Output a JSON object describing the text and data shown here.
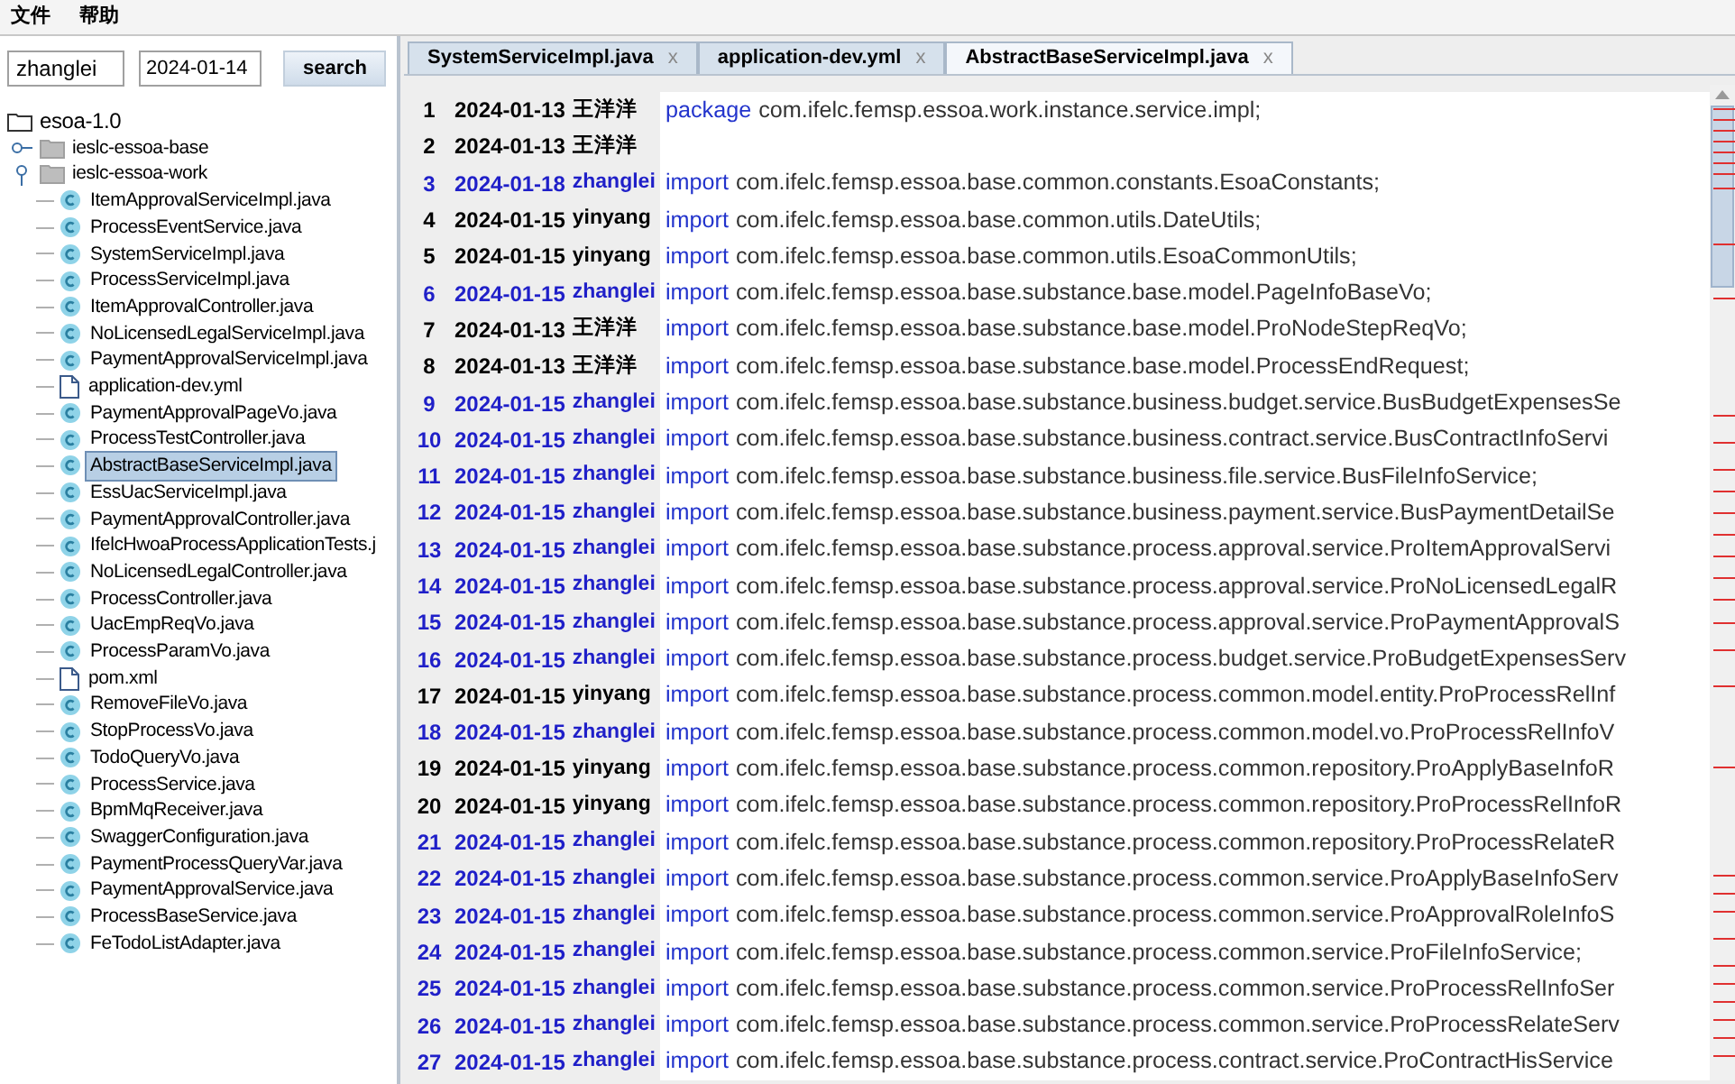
{
  "menu": [
    "文件",
    "帮助"
  ],
  "search": {
    "author": "zhanglei",
    "date": "2024-01-14",
    "button": "search"
  },
  "tree": {
    "label": "esoa-1.0",
    "expanded": true,
    "children": [
      {
        "label": "ieslc-essoa-base",
        "expanded": false
      },
      {
        "label": "ieslc-essoa-work",
        "expanded": true,
        "children": [
          {
            "label": "ItemApprovalServiceImpl.java",
            "kind": "java",
            "selected": false
          },
          {
            "label": "ProcessEventService.java",
            "kind": "java",
            "selected": false
          },
          {
            "label": "SystemServiceImpl.java",
            "kind": "java",
            "selected": false
          },
          {
            "label": "ProcessServiceImpl.java",
            "kind": "java",
            "selected": false
          },
          {
            "label": "ItemApprovalController.java",
            "kind": "java",
            "selected": false
          },
          {
            "label": "NoLicensedLegalServiceImpl.java",
            "kind": "java",
            "selected": false
          },
          {
            "label": "PaymentApprovalServiceImpl.java",
            "kind": "java",
            "selected": false
          },
          {
            "label": "application-dev.yml",
            "kind": "file",
            "selected": false
          },
          {
            "label": "PaymentApprovalPageVo.java",
            "kind": "java",
            "selected": false
          },
          {
            "label": "ProcessTestController.java",
            "kind": "java",
            "selected": false
          },
          {
            "label": "AbstractBaseServiceImpl.java",
            "kind": "java",
            "selected": true
          },
          {
            "label": "EssUacServiceImpl.java",
            "kind": "java",
            "selected": false
          },
          {
            "label": "PaymentApprovalController.java",
            "kind": "java",
            "selected": false
          },
          {
            "label": "IfelcHwoaProcessApplicationTests.j",
            "kind": "java",
            "selected": false
          },
          {
            "label": "NoLicensedLegalController.java",
            "kind": "java",
            "selected": false
          },
          {
            "label": "ProcessController.java",
            "kind": "java",
            "selected": false
          },
          {
            "label": "UacEmpReqVo.java",
            "kind": "java",
            "selected": false
          },
          {
            "label": "ProcessParamVo.java",
            "kind": "java",
            "selected": false
          },
          {
            "label": "pom.xml",
            "kind": "file",
            "selected": false
          },
          {
            "label": "RemoveFileVo.java",
            "kind": "java",
            "selected": false
          },
          {
            "label": "StopProcessVo.java",
            "kind": "java",
            "selected": false
          },
          {
            "label": "TodoQueryVo.java",
            "kind": "java",
            "selected": false
          },
          {
            "label": "ProcessService.java",
            "kind": "java",
            "selected": false
          },
          {
            "label": "BpmMqReceiver.java",
            "kind": "java",
            "selected": false
          },
          {
            "label": "SwaggerConfiguration.java",
            "kind": "java",
            "selected": false
          },
          {
            "label": "PaymentProcessQueryVar.java",
            "kind": "java",
            "selected": false
          },
          {
            "label": "PaymentApprovalService.java",
            "kind": "java",
            "selected": false
          },
          {
            "label": "ProcessBaseService.java",
            "kind": "java",
            "selected": false
          },
          {
            "label": "FeTodoListAdapter.java",
            "kind": "java",
            "selected": false
          }
        ]
      }
    ]
  },
  "tabs": [
    {
      "label": "SystemServiceImpl.java",
      "close": "x",
      "selected": false
    },
    {
      "label": "application-dev.yml",
      "close": "x",
      "selected": false
    },
    {
      "label": "AbstractBaseServiceImpl.java",
      "close": "x",
      "selected": true
    }
  ],
  "lines": [
    {
      "number": "1",
      "date": "2024-01-13",
      "author": "王洋洋",
      "color": "#000000",
      "keyword": "package",
      "code": "com.ifelc.femsp.essoa.work.instance.service.impl;"
    },
    {
      "number": "2",
      "date": "2024-01-13",
      "author": "王洋洋",
      "color": "#000000"
    },
    {
      "number": "3",
      "date": "2024-01-18",
      "author": "zhanglei",
      "color": "#1f1fc8",
      "keyword": "import",
      "code": "com.ifelc.femsp.essoa.base.common.constants.EsoaConstants;"
    },
    {
      "number": "4",
      "date": "2024-01-15",
      "author": "yinyang",
      "color": "#000000",
      "keyword": "import",
      "code": "com.ifelc.femsp.essoa.base.common.utils.DateUtils;"
    },
    {
      "number": "5",
      "date": "2024-01-15",
      "author": "yinyang",
      "color": "#000000",
      "keyword": "import",
      "code": "com.ifelc.femsp.essoa.base.common.utils.EsoaCommonUtils;"
    },
    {
      "number": "6",
      "date": "2024-01-15",
      "author": "zhanglei",
      "color": "#1f1fc8",
      "keyword": "import",
      "code": "com.ifelc.femsp.essoa.base.substance.base.model.PageInfoBaseVo;"
    },
    {
      "number": "7",
      "date": "2024-01-13",
      "author": "王洋洋",
      "color": "#000000",
      "keyword": "import",
      "code": "com.ifelc.femsp.essoa.base.substance.base.model.ProNodeStepReqVo;"
    },
    {
      "number": "8",
      "date": "2024-01-13",
      "author": "王洋洋",
      "color": "#000000",
      "keyword": "import",
      "code": "com.ifelc.femsp.essoa.base.substance.base.model.ProcessEndRequest;"
    },
    {
      "number": "9",
      "date": "2024-01-15",
      "author": "zhanglei",
      "color": "#1f1fc8",
      "keyword": "import",
      "code": "com.ifelc.femsp.essoa.base.substance.business.budget.service.BusBudgetExpensesSe"
    },
    {
      "number": "10",
      "date": "2024-01-15",
      "author": "zhanglei",
      "color": "#1f1fc8",
      "keyword": "import",
      "code": "com.ifelc.femsp.essoa.base.substance.business.contract.service.BusContractInfoServi"
    },
    {
      "number": "11",
      "date": "2024-01-15",
      "author": "zhanglei",
      "color": "#1f1fc8",
      "keyword": "import",
      "code": "com.ifelc.femsp.essoa.base.substance.business.file.service.BusFileInfoService;"
    },
    {
      "number": "12",
      "date": "2024-01-15",
      "author": "zhanglei",
      "color": "#1f1fc8",
      "keyword": "import",
      "code": "com.ifelc.femsp.essoa.base.substance.business.payment.service.BusPaymentDetailSe"
    },
    {
      "number": "13",
      "date": "2024-01-15",
      "author": "zhanglei",
      "color": "#1f1fc8",
      "keyword": "import",
      "code": "com.ifelc.femsp.essoa.base.substance.process.approval.service.ProItemApprovalServi"
    },
    {
      "number": "14",
      "date": "2024-01-15",
      "author": "zhanglei",
      "color": "#1f1fc8",
      "keyword": "import",
      "code": "com.ifelc.femsp.essoa.base.substance.process.approval.service.ProNoLicensedLegalR"
    },
    {
      "number": "15",
      "date": "2024-01-15",
      "author": "zhanglei",
      "color": "#1f1fc8",
      "keyword": "import",
      "code": "com.ifelc.femsp.essoa.base.substance.process.approval.service.ProPaymentApprovalS"
    },
    {
      "number": "16",
      "date": "2024-01-15",
      "author": "zhanglei",
      "color": "#1f1fc8",
      "keyword": "import",
      "code": "com.ifelc.femsp.essoa.base.substance.process.budget.service.ProBudgetExpensesServ"
    },
    {
      "number": "17",
      "date": "2024-01-15",
      "author": "yinyang",
      "color": "#000000",
      "keyword": "import",
      "code": "com.ifelc.femsp.essoa.base.substance.process.common.model.entity.ProProcessRelInf"
    },
    {
      "number": "18",
      "date": "2024-01-15",
      "author": "zhanglei",
      "color": "#1f1fc8",
      "keyword": "import",
      "code": "com.ifelc.femsp.essoa.base.substance.process.common.model.vo.ProProcessRelInfoV"
    },
    {
      "number": "19",
      "date": "2024-01-15",
      "author": "yinyang",
      "color": "#000000",
      "keyword": "import",
      "code": "com.ifelc.femsp.essoa.base.substance.process.common.repository.ProApplyBaseInfoR"
    },
    {
      "number": "20",
      "date": "2024-01-15",
      "author": "yinyang",
      "color": "#000000",
      "keyword": "import",
      "code": "com.ifelc.femsp.essoa.base.substance.process.common.repository.ProProcessRelInfoR"
    },
    {
      "number": "21",
      "date": "2024-01-15",
      "author": "zhanglei",
      "color": "#1f1fc8",
      "keyword": "import",
      "code": "com.ifelc.femsp.essoa.base.substance.process.common.repository.ProProcessRelateR"
    },
    {
      "number": "22",
      "date": "2024-01-15",
      "author": "zhanglei",
      "color": "#1f1fc8",
      "keyword": "import",
      "code": "com.ifelc.femsp.essoa.base.substance.process.common.service.ProApplyBaseInfoServ"
    },
    {
      "number": "23",
      "date": "2024-01-15",
      "author": "zhanglei",
      "color": "#1f1fc8",
      "keyword": "import",
      "code": "com.ifelc.femsp.essoa.base.substance.process.common.service.ProApprovalRoleInfoS"
    },
    {
      "number": "24",
      "date": "2024-01-15",
      "author": "zhanglei",
      "color": "#1f1fc8",
      "keyword": "import",
      "code": "com.ifelc.femsp.essoa.base.substance.process.common.service.ProFileInfoService;"
    },
    {
      "number": "25",
      "date": "2024-01-15",
      "author": "zhanglei",
      "color": "#1f1fc8",
      "keyword": "import",
      "code": "com.ifelc.femsp.essoa.base.substance.process.common.service.ProProcessRelInfoSer"
    },
    {
      "number": "26",
      "date": "2024-01-15",
      "author": "zhanglei",
      "color": "#1f1fc8",
      "keyword": "import",
      "code": "com.ifelc.femsp.essoa.base.substance.process.common.service.ProProcessRelateServ"
    },
    {
      "number": "27",
      "date": "2024-01-15",
      "author": "zhanglei",
      "color": "#1f1fc8",
      "keyword": "import",
      "code": "com.ifelc.femsp.essoa.base.substance.process.contract.service.ProContractHisService"
    }
  ]
}
